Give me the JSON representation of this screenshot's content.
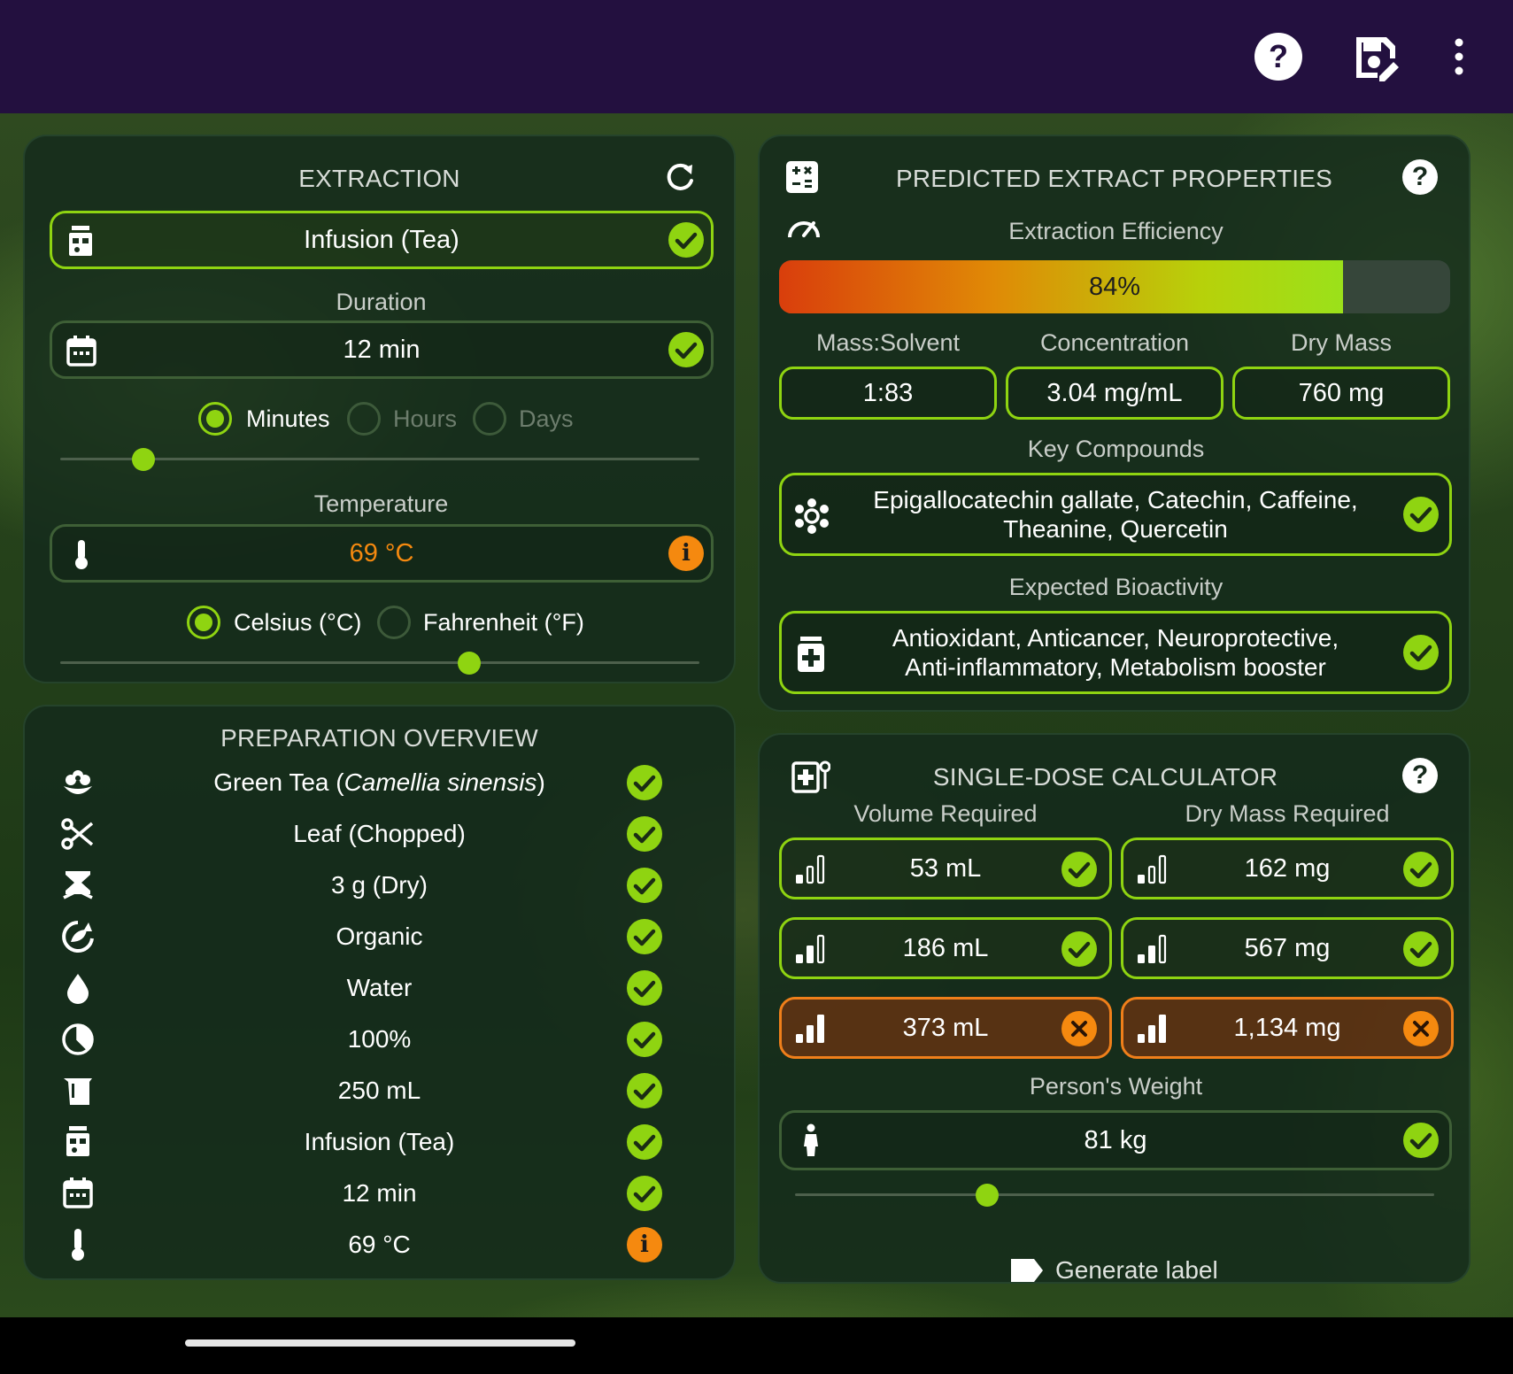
{
  "toolbar": {
    "icons": [
      "help-icon",
      "save-edit-icon",
      "more-vert-icon"
    ]
  },
  "colors": {
    "accent": "#8fd411",
    "warning": "#f5890f",
    "topbar": "#23103f",
    "panel": "#142a1c"
  },
  "extraction": {
    "title": "EXTRACTION",
    "method": "Infusion (Tea)",
    "duration_label": "Duration",
    "duration_value": "12 min",
    "duration_units": [
      "Minutes",
      "Hours",
      "Days"
    ],
    "duration_selected": "Minutes",
    "duration_slider": 0.13,
    "temperature_label": "Temperature",
    "temperature_value": "69 °C",
    "temperature_units": [
      "Celsius (°C)",
      "Fahrenheit (°F)"
    ],
    "temperature_selected": "Celsius (°C)",
    "temperature_slider": 0.64
  },
  "overview": {
    "title": "PREPARATION OVERVIEW",
    "rows": [
      {
        "icon": "flower-icon",
        "text_main": "Green Tea (",
        "text_italic": "Camellia sinensis",
        "text_end": ")",
        "status": "ok"
      },
      {
        "icon": "scissors-icon",
        "text": "Leaf (Chopped)",
        "status": "ok"
      },
      {
        "icon": "scale-icon",
        "text": "3 g (Dry)",
        "status": "ok"
      },
      {
        "icon": "organic-icon",
        "text": "Organic",
        "status": "ok"
      },
      {
        "icon": "drop-icon",
        "text": "Water",
        "status": "ok"
      },
      {
        "icon": "pie-icon",
        "text": "100%",
        "status": "ok"
      },
      {
        "icon": "beaker-icon",
        "text": "250 mL",
        "status": "ok"
      },
      {
        "icon": "kettle-icon",
        "text": "Infusion (Tea)",
        "status": "ok"
      },
      {
        "icon": "calendar-icon",
        "text": "12 min",
        "status": "ok"
      },
      {
        "icon": "thermometer-icon",
        "text": "69 °C",
        "status": "info"
      }
    ]
  },
  "predicted": {
    "title": "PREDICTED EXTRACT PROPERTIES",
    "efficiency_label": "Extraction Efficiency",
    "efficiency_value": "84%",
    "efficiency_fraction": 0.84,
    "stats": [
      {
        "label": "Mass:Solvent",
        "value": "1:83"
      },
      {
        "label": "Concentration",
        "value": "3.04 mg/mL"
      },
      {
        "label": "Dry Mass",
        "value": "760 mg"
      }
    ],
    "compounds_label": "Key Compounds",
    "compounds_line1": "Epigallocatechin gallate, Catechin, Caffeine,",
    "compounds_line2": "Theanine, Quercetin",
    "bioactivity_label": "Expected Bioactivity",
    "bioactivity_line1": "Antioxidant, Anticancer, Neuroprotective,",
    "bioactivity_line2": "Anti-inflammatory, Metabolism booster"
  },
  "dose": {
    "title": "SINGLE-DOSE CALCULATOR",
    "volume_label": "Volume Required",
    "mass_label": "Dry Mass Required",
    "rows": [
      {
        "volume": "53 mL",
        "mass": "162 mg",
        "status": "ok",
        "level": 1
      },
      {
        "volume": "186 mL",
        "mass": "567 mg",
        "status": "ok",
        "level": 2
      },
      {
        "volume": "373 mL",
        "mass": "1,134 mg",
        "status": "warn",
        "level": 3
      }
    ],
    "weight_label": "Person's Weight",
    "weight_value": "81 kg",
    "weight_slider": 0.3,
    "generate_label": "Generate label"
  }
}
